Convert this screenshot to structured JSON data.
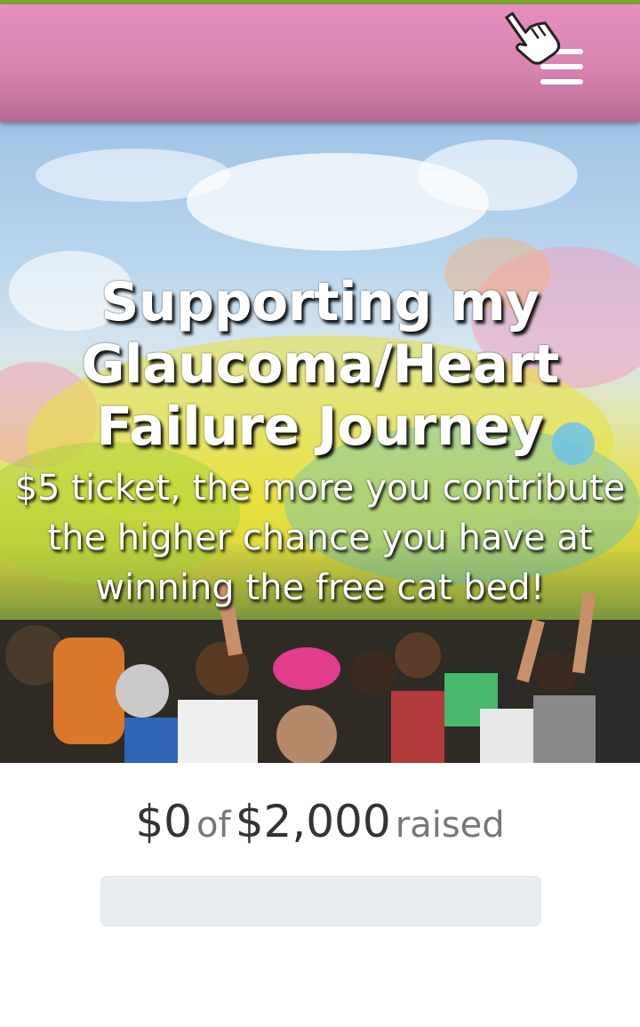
{
  "header": {
    "bg_color": "#df8ab9",
    "top_line_color": "#7fa534",
    "menu_icon": "hamburger-menu-icon",
    "pointer_icon": "pointing-hand-cursor-icon"
  },
  "hero": {
    "title": "Supporting my Glaucoma/Heart Failure Journey",
    "subtitle": "$5 ticket, the more you contribute the higher chance you have at winning the free cat bed!"
  },
  "fundraiser": {
    "raised_amount": "$0",
    "of_text": "of",
    "goal_amount": "$2,000",
    "raised_text": "raised",
    "progress_fraction": 0
  }
}
